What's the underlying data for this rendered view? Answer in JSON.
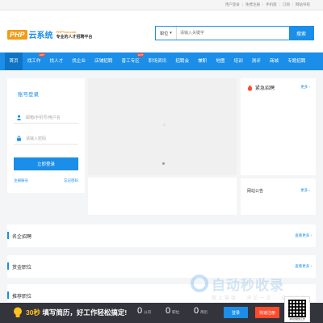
{
  "topbar": {
    "links": [
      "用户登录",
      "免费注册",
      "手机版",
      "订阅",
      "网站导航"
    ]
  },
  "logo": {
    "badge": "PHP",
    "cn": "云系统",
    "domain": "PHPYun.com",
    "slogan": "专业的人才招聘平台"
  },
  "search": {
    "category": "职位",
    "placeholder": "请输入关键字",
    "button": "搜索"
  },
  "nav": {
    "items": [
      {
        "label": "首页",
        "hot": ""
      },
      {
        "label": "找工作",
        "hot": "HOT"
      },
      {
        "label": "找人才",
        "hot": ""
      },
      {
        "label": "找企业",
        "hot": ""
      },
      {
        "label": "店铺招聘",
        "hot": ""
      },
      {
        "label": "普工专区",
        "hot": "HOT"
      },
      {
        "label": "职场资讯",
        "hot": ""
      },
      {
        "label": "招聘会",
        "hot": ""
      },
      {
        "label": "兼职",
        "hot": ""
      },
      {
        "label": "地图",
        "hot": ""
      },
      {
        "label": "培训",
        "hot": ""
      },
      {
        "label": "测评",
        "hot": ""
      },
      {
        "label": "商城",
        "hot": ""
      },
      {
        "label": "专题招聘",
        "hot": ""
      }
    ]
  },
  "login": {
    "title": "账号登录",
    "user_placeholder": "邮箱/手机号/用户名",
    "pass_placeholder": "请输入密码",
    "submit": "立即登录",
    "register": "注册账号",
    "forgot": "忘记密码"
  },
  "urgent": {
    "title": "紧急招聘",
    "more": "更多"
  },
  "notice": {
    "title": "网站公告",
    "more": "更多"
  },
  "sections": [
    {
      "title": "名企招聘",
      "more": "查看更多"
    },
    {
      "title": "赏金职位",
      "more": "查看更多"
    },
    {
      "title": "推荐职位",
      "more": ""
    }
  ],
  "bottombar": {
    "promo_highlight": "30秒",
    "promo_text": "填写简历，好工作轻松搞定!",
    "companies_num": "0",
    "companies_label": "公司",
    "jobs_num": "0",
    "jobs_label": "职位",
    "resumes_num": "0",
    "resumes_label": "简历",
    "login": "登录",
    "register": "快速注册",
    "qr_caption": "手机也能找工作"
  },
  "watermark": {
    "text": "自动秒收录",
    "sub": "做上链接 · 来访一次 · 自动收录"
  },
  "colors": {
    "primary": "#1a8ee8",
    "accent": "#f39a16",
    "hot": "#ff4b2b",
    "highlight": "#ffc21a"
  }
}
